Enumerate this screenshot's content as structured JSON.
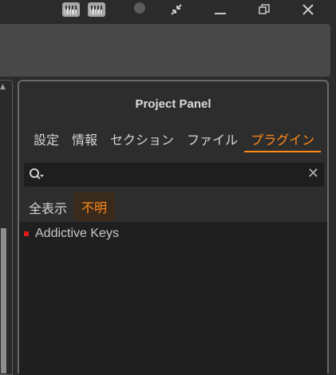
{
  "title_bar": {
    "icons": [
      "keyboard-icon",
      "keyboard-icon",
      "record-dot",
      "collapse-arrows-icon",
      "minimize-icon",
      "restore-icon",
      "close-icon"
    ]
  },
  "project_panel": {
    "title": "Project Panel",
    "tabs": [
      {
        "label": "設定",
        "active": false
      },
      {
        "label": "情報",
        "active": false
      },
      {
        "label": "セクション",
        "active": false
      },
      {
        "label": "ファイル",
        "active": false
      },
      {
        "label": "プラグイン",
        "active": true
      }
    ],
    "search": {
      "value": "",
      "clear_icon": "close-icon"
    },
    "filters": {
      "all_label": "全表示",
      "unknown_label": "不明"
    },
    "plugins": [
      {
        "name": "Addictive Keys",
        "status_color": "#e01818"
      }
    ]
  },
  "colors": {
    "accent": "#ff8a1a",
    "background": "#2b2b2b"
  }
}
